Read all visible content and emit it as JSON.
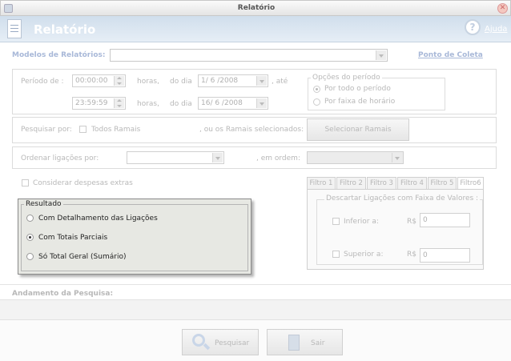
{
  "window": {
    "title": "Relatório"
  },
  "header": {
    "title": "Relatório",
    "help_label": "Ajuda"
  },
  "models": {
    "label": "Modelos de Relatórios:",
    "value": "",
    "link": "Ponto de Coleta"
  },
  "period": {
    "label": "Período de :",
    "start_time": "00:00:00",
    "end_time": "23:59:59",
    "hours_label_1": "horas,",
    "hours_label_2": "horas,",
    "day_label_1": "do dia",
    "day_label_2": "do dia",
    "start_date": "1/ 6 /2008",
    "end_date": "16/ 6 /2008",
    "until_label": ", até",
    "options_title": "Opções do período",
    "option_all": "Por todo o período",
    "option_range": "Por faixa de horário",
    "selected_option": "all"
  },
  "search": {
    "label": "Pesquisar por:",
    "all_extensions": "Todos Ramais",
    "or_label": ", ou os Ramais selecionados:",
    "select_button": "Selecionar Ramais"
  },
  "order": {
    "label": "Ordenar ligações por:",
    "value": "",
    "in_order_label": ", em ordem:",
    "order_value": ""
  },
  "extras": {
    "label": "Considerar despesas extras",
    "checked": false
  },
  "result": {
    "title": "Resultado",
    "options": [
      "Com Detalhamento das Ligações",
      "Com Totais Parciais",
      "Só Total Geral (Sumário)"
    ],
    "selected_index": 1
  },
  "filters": {
    "tabs": [
      "Filtro 1",
      "Filtro 2",
      "Filtro 3",
      "Filtro 4",
      "Filtro 5",
      "Filtro6"
    ],
    "selected_tab": 5,
    "group_title": "Descartar Ligações com Faixa de Valores :",
    "lower_label": "Inferior a:",
    "upper_label": "Superior a:",
    "currency": "R$",
    "lower_value": "0",
    "upper_value": "0"
  },
  "progress": {
    "label": "Andamento da Pesquisa:"
  },
  "footer": {
    "search_button": "Pesquisar",
    "exit_button": "Sair"
  }
}
